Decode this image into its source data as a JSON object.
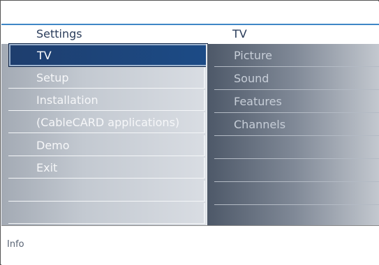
{
  "header": {
    "left_title": "Settings",
    "right_title": "TV"
  },
  "settings_menu": {
    "items": [
      {
        "label": "TV",
        "selected": true
      },
      {
        "label": "Setup"
      },
      {
        "label": "Installation"
      },
      {
        "label": "(CableCARD applications)"
      },
      {
        "label": "Demo"
      },
      {
        "label": "Exit"
      },
      {
        "label": ""
      },
      {
        "label": ""
      }
    ]
  },
  "submenu": {
    "items": [
      {
        "label": "Picture"
      },
      {
        "label": "Sound"
      },
      {
        "label": "Features"
      },
      {
        "label": "Channels"
      },
      {
        "label": ""
      },
      {
        "label": ""
      },
      {
        "label": ""
      },
      {
        "label": ""
      }
    ]
  },
  "info": {
    "label": "Info"
  },
  "colors": {
    "accent_line": "#3f86c6",
    "selected_item": "#1e3e6e",
    "title_text": "#2a3c5a"
  }
}
